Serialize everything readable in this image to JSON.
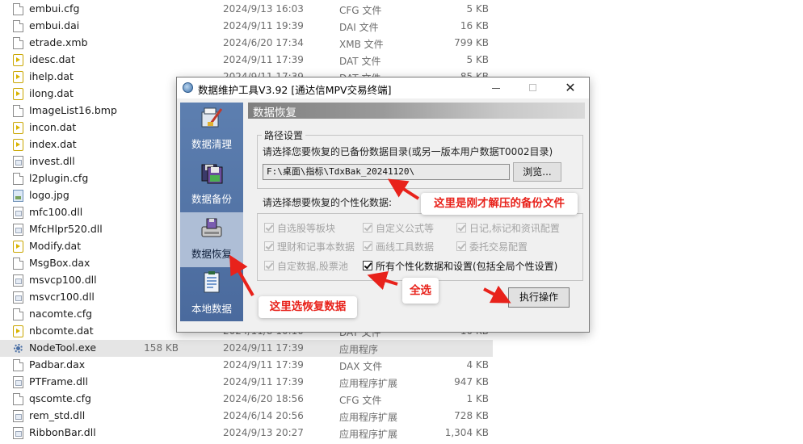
{
  "files": [
    {
      "name": "embui.cfg",
      "date": "2024/9/13 16:03",
      "type": "CFG 文件",
      "size": "5 KB",
      "icon": "document-icon"
    },
    {
      "name": "embui.dai",
      "date": "2024/9/11 19:39",
      "type": "DAI 文件",
      "size": "16 KB",
      "icon": "document-icon"
    },
    {
      "name": "etrade.xmb",
      "date": "2024/6/20 17:34",
      "type": "XMB 文件",
      "size": "799 KB",
      "icon": "document-icon"
    },
    {
      "name": "idesc.dat",
      "date": "2024/9/11 17:39",
      "type": "DAT 文件",
      "size": "5 KB",
      "icon": "dat-file-icon"
    },
    {
      "name": "ihelp.dat",
      "date": "2024/9/11 17:39",
      "type": "DAT 文件",
      "size": "85 KB",
      "icon": "dat-file-icon"
    },
    {
      "name": "ilong.dat",
      "date": "",
      "type": "",
      "size": "",
      "icon": "dat-file-icon"
    },
    {
      "name": "ImageList16.bmp",
      "date": "",
      "type": "",
      "size": "",
      "icon": "document-icon"
    },
    {
      "name": "incon.dat",
      "date": "",
      "type": "",
      "size": "",
      "icon": "dat-file-icon"
    },
    {
      "name": "index.dat",
      "date": "",
      "type": "",
      "size": "",
      "icon": "dat-file-icon"
    },
    {
      "name": "invest.dll",
      "date": "",
      "type": "",
      "size": "",
      "icon": "dll-file-icon"
    },
    {
      "name": "l2plugin.cfg",
      "date": "",
      "type": "",
      "size": "",
      "icon": "document-icon"
    },
    {
      "name": "logo.jpg",
      "date": "",
      "type": "",
      "size": "",
      "icon": "image-file-icon"
    },
    {
      "name": "mfc100.dll",
      "date": "",
      "type": "",
      "size": "",
      "icon": "dll-file-icon"
    },
    {
      "name": "MfcHlpr520.dll",
      "date": "",
      "type": "",
      "size": "",
      "icon": "dll-file-icon"
    },
    {
      "name": "Modify.dat",
      "date": "",
      "type": "",
      "size": "",
      "icon": "dat-file-icon"
    },
    {
      "name": "MsgBox.dax",
      "date": "",
      "type": "",
      "size": "",
      "icon": "document-icon"
    },
    {
      "name": "msvcp100.dll",
      "date": "",
      "type": "",
      "size": "",
      "icon": "dll-file-icon"
    },
    {
      "name": "msvcr100.dll",
      "date": "",
      "type": "",
      "size": "",
      "icon": "dll-file-icon"
    },
    {
      "name": "nacomte.cfg",
      "date": "",
      "type": "",
      "size": "",
      "icon": "document-icon"
    },
    {
      "name": "nbcomte.dat",
      "date": "2024/11/8 10:10",
      "type": "DAT 文件",
      "size": "10 KB",
      "icon": "dat-file-icon"
    },
    {
      "name": "NodeTool.exe",
      "date": "2024/9/11 17:39",
      "type": "应用程序",
      "size": "158 KB",
      "icon": "exe-gear-icon",
      "selected": true
    },
    {
      "name": "Padbar.dax",
      "date": "2024/9/11 17:39",
      "type": "DAX 文件",
      "size": "4 KB",
      "icon": "document-icon"
    },
    {
      "name": "PTFrame.dll",
      "date": "2024/9/11 17:39",
      "type": "应用程序扩展",
      "size": "947 KB",
      "icon": "dll-file-icon"
    },
    {
      "name": "qscomte.cfg",
      "date": "2024/6/20 18:56",
      "type": "CFG 文件",
      "size": "1 KB",
      "icon": "document-icon"
    },
    {
      "name": "rem_std.dll",
      "date": "2024/6/14 20:56",
      "type": "应用程序扩展",
      "size": "728 KB",
      "icon": "dll-file-icon"
    },
    {
      "name": "RibbonBar.dll",
      "date": "2024/9/13 20:27",
      "type": "应用程序扩展",
      "size": "1,304 KB",
      "icon": "dll-file-icon"
    }
  ],
  "dialog": {
    "title": "数据维护工具V3.92 [通达信MPV交易终端]",
    "sidebar": [
      {
        "label": "数据清理",
        "icon": "cleanup-icon",
        "active": false
      },
      {
        "label": "数据备份",
        "icon": "backup-icon",
        "active": false
      },
      {
        "label": "数据恢复",
        "icon": "restore-icon",
        "active": true
      },
      {
        "label": "本地数据",
        "icon": "local-data-icon",
        "active": false
      }
    ],
    "panel_title": "数据恢复",
    "path_group_title": "路径设置",
    "path_prompt": "请选择您要恢复的已备份数据目录(或另一版本用户数据T0002目录)",
    "path_value": "F:\\桌面\\指标\\TdxBak_20241120\\",
    "browse_label": "浏览...",
    "data_prompt": "请选择想要恢复的个性化数据:",
    "checkboxes": [
      {
        "label": "自选股等板块",
        "checked": true,
        "enabled": false
      },
      {
        "label": "自定义公式等",
        "checked": true,
        "enabled": false
      },
      {
        "label": "日记,标记和资讯配置",
        "checked": true,
        "enabled": false
      },
      {
        "label": "理财和记事本数据",
        "checked": true,
        "enabled": false
      },
      {
        "label": "画线工具数据",
        "checked": true,
        "enabled": false
      },
      {
        "label": "委托交易配置",
        "checked": true,
        "enabled": false
      },
      {
        "label": "自定数据,股票池",
        "checked": true,
        "enabled": false
      },
      {
        "label": "所有个性化数据和设置(包括全局个性设置)",
        "checked": true,
        "enabled": true
      }
    ],
    "execute_label": "执行操作"
  },
  "annotations": {
    "backup_file_note": "这里是刚才解压的备份文件",
    "select_all_note": "全选",
    "select_restore_note": "这里选恢复数据",
    "color": "#e8221b"
  }
}
